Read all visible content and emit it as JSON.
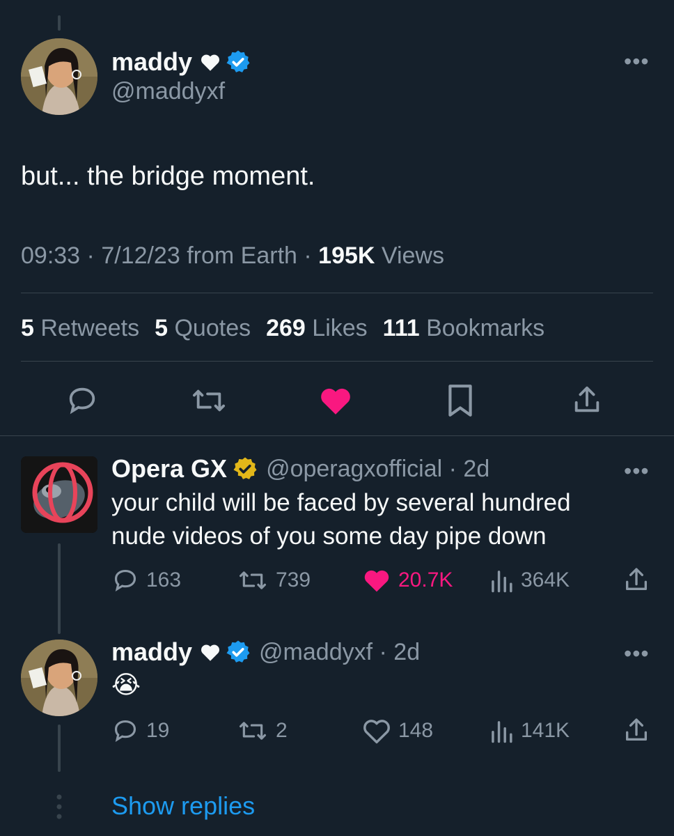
{
  "main_tweet": {
    "name": "maddy",
    "handle": "@maddyxf",
    "text": "but... the bridge moment.",
    "time": "09:33",
    "date": "7/12/23",
    "source": "from Earth",
    "views_count": "195K",
    "views_label": "Views",
    "stats": {
      "retweets_count": "5",
      "retweets_label": "Retweets",
      "quotes_count": "5",
      "quotes_label": "Quotes",
      "likes_count": "269",
      "likes_label": "Likes",
      "bookmarks_count": "111",
      "bookmarks_label": "Bookmarks"
    }
  },
  "reply1": {
    "name": "Opera GX",
    "handle": "@operagxofficial",
    "age": "2d",
    "text_line1": "your child will be faced by several hundred",
    "text_line2": "nude videos of you some day pipe down",
    "replies": "163",
    "retweets": "739",
    "likes": "20.7K",
    "views": "364K"
  },
  "reply2": {
    "name": "maddy",
    "handle": "@maddyxf",
    "age": "2d",
    "text": "😭",
    "replies": "19",
    "retweets": "2",
    "likes": "148",
    "views": "141K"
  },
  "show_replies": "Show replies",
  "colors": {
    "background": "#15202b",
    "accent": "#1d9bf0",
    "like": "#f91880",
    "gold": "#e2b719"
  },
  "icons": [
    "heart-icon",
    "verified-badge-icon",
    "gold-verified-badge-icon",
    "more-icon",
    "reply-icon",
    "retweet-icon",
    "like-icon",
    "bookmark-icon",
    "share-icon",
    "views-icon"
  ]
}
